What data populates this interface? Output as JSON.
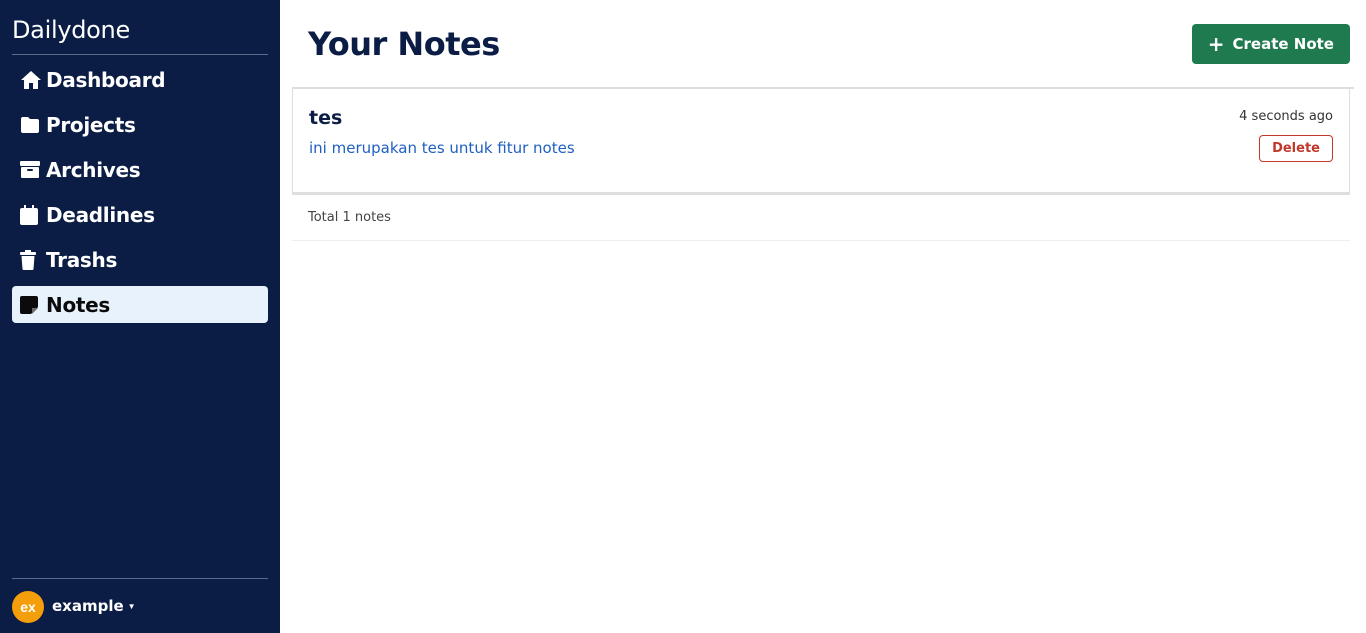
{
  "sidebar": {
    "brand": "Dailydone",
    "items": [
      {
        "label": "Dashboard",
        "icon": "home-icon"
      },
      {
        "label": "Projects",
        "icon": "folder-icon"
      },
      {
        "label": "Archives",
        "icon": "archive-icon"
      },
      {
        "label": "Deadlines",
        "icon": "calendar-icon"
      },
      {
        "label": "Trashs",
        "icon": "trash-icon"
      },
      {
        "label": "Notes",
        "icon": "sticky-note-icon",
        "active": true
      }
    ],
    "user": {
      "initials": "ex",
      "name": "example",
      "avatar_color": "#f59e0b"
    }
  },
  "main": {
    "title": "Your Notes",
    "create_button": "Create Note",
    "notes": [
      {
        "title": "tes",
        "body": "ini merupakan tes untuk fitur notes",
        "time": "4 seconds ago",
        "delete_label": "Delete"
      }
    ],
    "total_text": "Total 1 notes"
  },
  "colors": {
    "sidebar_bg": "#0b1d45",
    "active_bg": "#e8f2fd",
    "accent_green": "#1f7a4f",
    "delete_red": "#c0392b",
    "link_blue": "#1e5fc2"
  }
}
